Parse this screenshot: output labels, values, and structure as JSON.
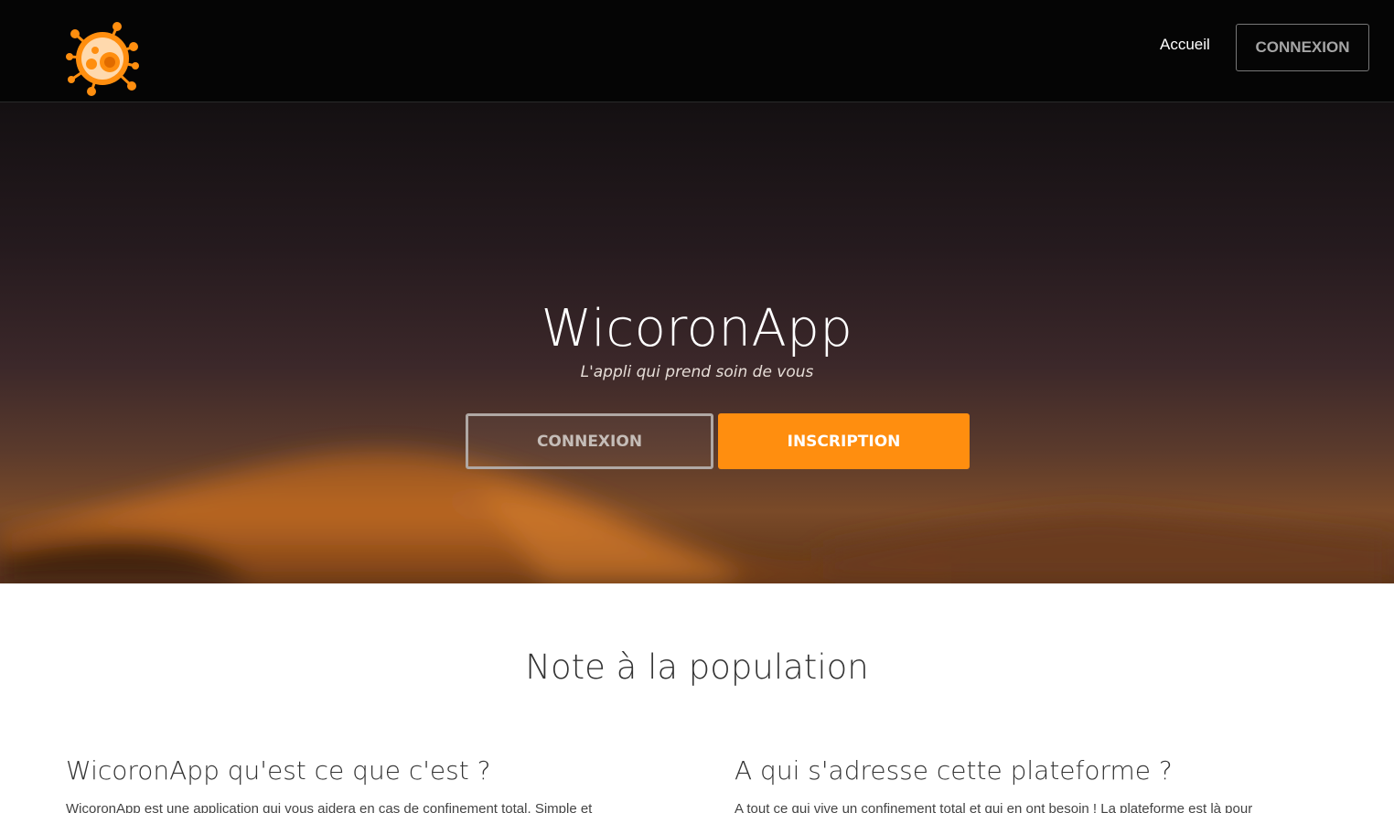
{
  "nav": {
    "logo_icon": "virus-logo-icon",
    "home_link": "Accueil",
    "login_button": "CONNEXION"
  },
  "hero": {
    "title": "WicoronApp",
    "subtitle": "L'appli qui prend soin de vous",
    "login_button": "CONNEXION",
    "signup_button": "INSCRIPTION"
  },
  "content": {
    "section_title": "Note à la population",
    "columns": [
      {
        "title": "WicoronApp qu'est ce que c'est ?",
        "text": "WicoronApp est une application qui vous aidera en cas de confinement total. Simple et"
      },
      {
        "title": "A qui s'adresse cette plateforme ?",
        "text": "A tout ce qui vive un confinement total et qui en ont besoin ! La plateforme est là pour"
      }
    ]
  },
  "colors": {
    "accent": "#ff8e0f",
    "navbar": "#050505",
    "text_dark": "#333333"
  }
}
